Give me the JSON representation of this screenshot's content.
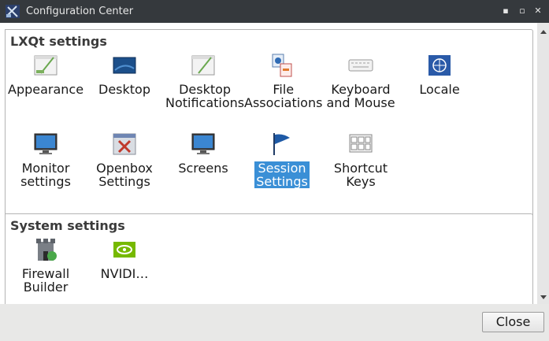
{
  "window": {
    "title": "Configuration Center",
    "controls": [
      "minimize-icon",
      "maximize-icon",
      "close-icon"
    ]
  },
  "groups": [
    {
      "title": "LXQt settings",
      "items": [
        {
          "label": "Appearance",
          "icon": "appearance-icon"
        },
        {
          "label": "Desktop",
          "icon": "desktop-icon"
        },
        {
          "label": "Desktop\nNotifications",
          "icon": "notifications-icon"
        },
        {
          "label": "File\nAssociations",
          "icon": "file-associations-icon"
        },
        {
          "label": "Keyboard\nand Mouse",
          "icon": "keyboard-icon"
        },
        {
          "label": "Locale",
          "icon": "globe-icon"
        },
        {
          "label": "Monitor\nsettings",
          "icon": "monitor-icon"
        },
        {
          "label": "Openbox\nSettings",
          "icon": "openbox-icon"
        },
        {
          "label": "Screens",
          "icon": "screens-icon"
        },
        {
          "label": "Session\nSettings",
          "icon": "flag-icon",
          "selected": true
        },
        {
          "label": "Shortcut\nKeys",
          "icon": "shortcut-keys-icon"
        }
      ]
    },
    {
      "title": "System settings",
      "items": [
        {
          "label": "Firewall\nBuilder",
          "icon": "firewall-icon"
        },
        {
          "label": "NVIDI…",
          "icon": "nvidia-icon"
        }
      ]
    }
  ],
  "footer": {
    "close_label": "Close"
  },
  "colors": {
    "titlebar": "#35393d",
    "selection": "#3a8fd6",
    "content": "#ffffff"
  }
}
